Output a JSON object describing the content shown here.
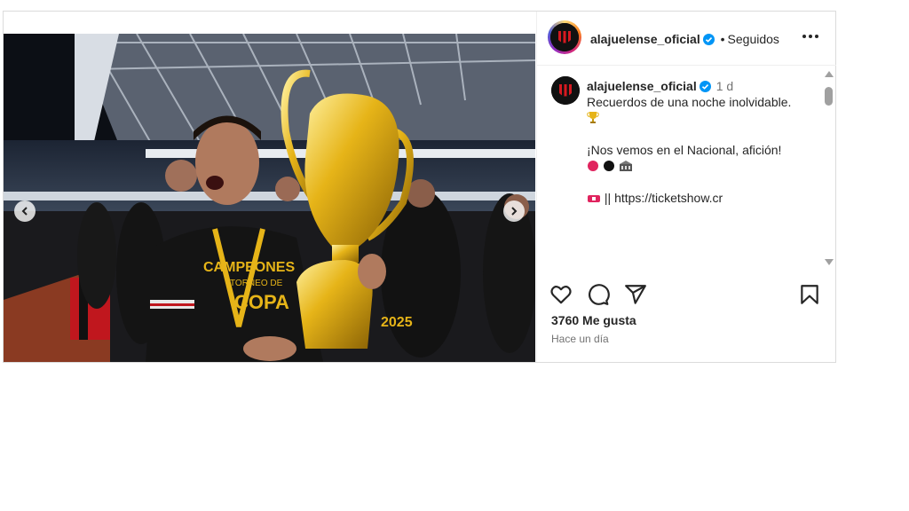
{
  "post": {
    "username": "alajuelense_oficial",
    "follow_status": "Seguidos",
    "separator": "•",
    "timestamp": "1 d",
    "caption": {
      "line1": "Recuerdos de una noche inolvidable.",
      "line2": "¡Nos vemos en el Nacional, afición!",
      "link": "https://ticketshow.cr",
      "link_prefix": "||"
    },
    "likes": "3760 Me gusta",
    "time_ago": "Hace un día"
  },
  "media": {
    "shirt_text_1": "CAMPEONES",
    "shirt_text_2": "TORNEO DE",
    "shirt_text_3": "COPA",
    "shirt_text_4": "2025"
  },
  "icons": {
    "prev": "chevron-left-icon",
    "next": "chevron-right-icon",
    "like": "heart-icon",
    "comment": "comment-icon",
    "share": "paper-plane-icon",
    "save": "bookmark-icon",
    "more": "more-options-icon",
    "verified": "verified-badge-icon"
  },
  "colors": {
    "verified": "#0095f6",
    "club_red": "#d71920",
    "gold": "#e6b418"
  }
}
